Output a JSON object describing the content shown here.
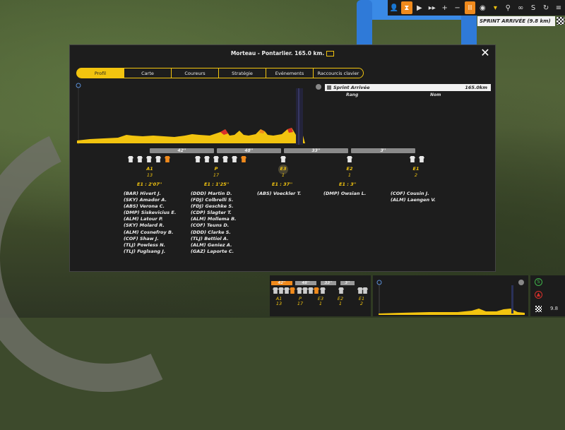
{
  "hud": {
    "sprint_label": "SPRINT ARRIVÉE (9.8 km)",
    "pause_label": "II",
    "icons": [
      "rider-icon",
      "hourglass-icon",
      "play-icon",
      "fast-forward-icon",
      "zoom-in-icon",
      "zoom-out-icon",
      "pause-icon",
      "eye-icon",
      "jersey-icon",
      "cyclist-icon",
      "bike-icon",
      "sprint-s-icon",
      "refresh-icon",
      "menu-icon"
    ]
  },
  "modal": {
    "title": "Morteau - Pontarlier. 165.0 km.",
    "tabs": [
      "Profil",
      "Carte",
      "Coureurs",
      "Stratégie",
      "Evénements",
      "Raccourcis clavier"
    ],
    "active_tab": "Profil"
  },
  "sprint_panel": {
    "name": "Sprint Arrivée",
    "distance": "165.0km",
    "col_rank": "Rang",
    "col_name": "Nom"
  },
  "gaps": [
    "42''",
    "48''",
    "33''",
    "3''"
  ],
  "groups": [
    {
      "label": "A1",
      "count": "13",
      "time": "E1 : 2'07''",
      "riders": [
        "(BAR) Hivert J.",
        "(SKY) Amador A.",
        "(ABS) Verona C.",
        "(DMP) Siskevicius E.",
        "(ALM) Latour P.",
        "(SKY) Molard R.",
        "(ALM) Cosnefroy B.",
        "(COF) Shaw J.",
        "(TLJ) Powless N.",
        "(TLJ) Fuglsang J."
      ]
    },
    {
      "label": "P",
      "count": "17",
      "time": "E1 : 1'25''",
      "riders": [
        "(DDD) Martin D.",
        "(FDJ) Colbrelli S.",
        "(FDJ) Geschke S.",
        "(CDP) Slagter T.",
        "(ALM) Mollema B.",
        "(COF) Teuns D.",
        "(DDD) Clarke S.",
        "(TLJ) Bettiol A.",
        "(ALM) Geniez A.",
        "(GAZ) Laporte C."
      ]
    },
    {
      "label": "E3",
      "count": "1",
      "time": "E1 : 37''",
      "riders": [
        "(ABS) Voeckler T."
      ]
    },
    {
      "label": "E2",
      "count": "1",
      "time": "E1 : 3''",
      "riders": [
        "(DMP) Owsian L."
      ]
    },
    {
      "label": "E1",
      "count": "2",
      "time": "",
      "riders": [
        "(COF) Cousin J.",
        "(ALM) Laengen V."
      ]
    }
  ],
  "bottom": {
    "gaps": [
      "42''",
      "48''",
      "33''",
      "3''"
    ],
    "labels": [
      [
        "A1",
        "13"
      ],
      [
        "P",
        "17"
      ],
      [
        "E3",
        "1"
      ],
      [
        "E2",
        "1"
      ],
      [
        "E1",
        "2"
      ]
    ],
    "remaining_km": "9.8"
  },
  "colors": {
    "accent": "#f2c40f",
    "orange": "#f08a1c",
    "panel": "#1d1d1d"
  }
}
